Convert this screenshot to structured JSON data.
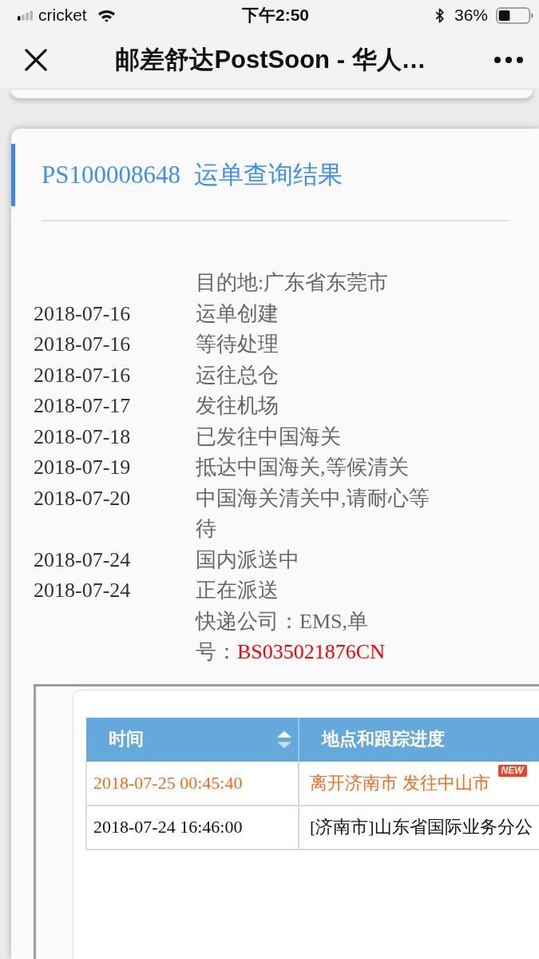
{
  "status_bar": {
    "carrier": "cricket",
    "time": "下午2:50",
    "battery": "36%"
  },
  "nav_bar": {
    "title": "邮差舒达PostSoon - 华人…"
  },
  "result_card": {
    "tracking_number": "PS100008648",
    "heading": "运单查询结果",
    "destination": "目的地:广东省东莞市",
    "events": [
      {
        "date": "2018-07-16",
        "status": "运单创建"
      },
      {
        "date": "2018-07-16",
        "status": "等待处理"
      },
      {
        "date": "2018-07-16",
        "status": "运往总仓"
      },
      {
        "date": "2018-07-17",
        "status": "发往机场"
      },
      {
        "date": "2018-07-18",
        "status": "已发往中国海关"
      },
      {
        "date": "2018-07-19",
        "status": "抵达中国海关,等候清关"
      },
      {
        "date": "2018-07-20",
        "status": "中国海关清关中,请耐心等待"
      },
      {
        "date": "2018-07-24",
        "status": "国内派送中"
      },
      {
        "date": "2018-07-24",
        "status": "正在派送"
      }
    ],
    "courier_label": "快递公司：EMS,单号：",
    "courier_number": "BS035021876CN"
  },
  "tracking_table": {
    "columns": [
      {
        "label": "时间",
        "sortable": true
      },
      {
        "label": "地点和跟踪进度",
        "sortable": false
      }
    ],
    "rows": [
      {
        "time": "2018-07-25 00:45:40",
        "event": "离开济南市 发往中山市",
        "latest": true,
        "badge": "NEW"
      },
      {
        "time": "2018-07-24 16:46:00",
        "event": "[济南市]山东省国际业务分公",
        "latest": false
      }
    ]
  }
}
